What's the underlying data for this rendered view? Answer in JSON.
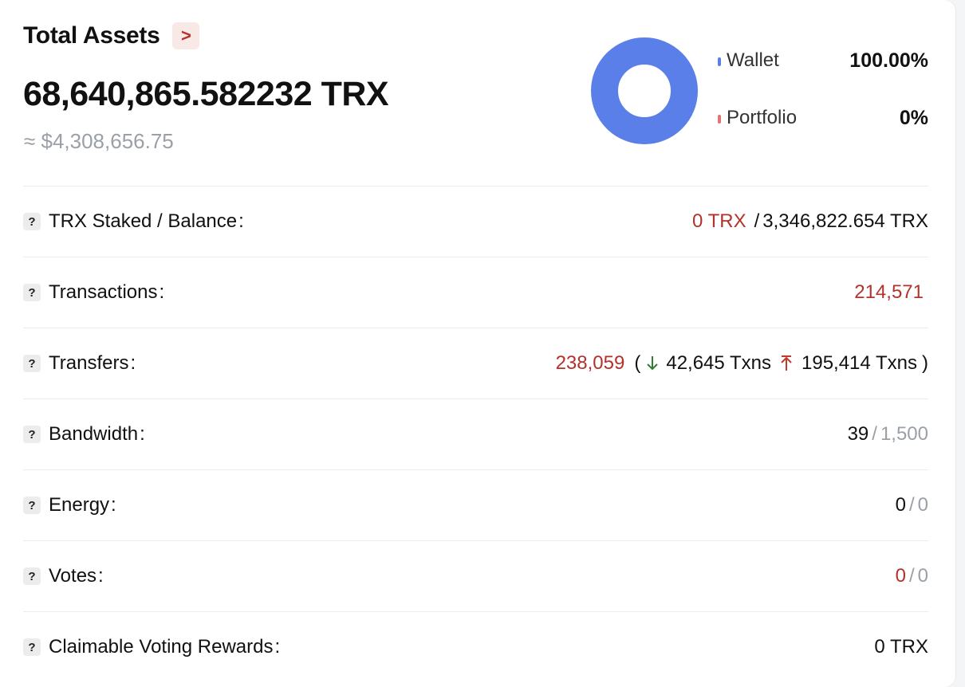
{
  "header": {
    "title": "Total Assets",
    "arrow": ">",
    "total": "68,640,865.582232 TRX",
    "usd": "≈ $4,308,656.75"
  },
  "chart_data": {
    "type": "pie",
    "categories": [
      "Wallet",
      "Portfolio"
    ],
    "values": [
      100.0,
      0
    ],
    "value_labels": [
      "100.00%",
      "0%"
    ],
    "colors": [
      "#5a7fe8",
      "#e57373"
    ]
  },
  "rows": {
    "staked": {
      "label": "TRX Staked / Balance",
      "colon": ":",
      "staked": "0 TRX",
      "slash": "/",
      "balance": "3,346,822.654 TRX"
    },
    "transactions": {
      "label": "Transactions",
      "colon": ":",
      "value": "214,571"
    },
    "transfers": {
      "label": "Transfers",
      "colon": ":",
      "total": "238,059",
      "open": "(",
      "in_count": "42,645 Txns",
      "out_count": "195,414 Txns",
      "close": ")"
    },
    "bandwidth": {
      "label": "Bandwidth",
      "colon": ":",
      "used": "39",
      "slash": "/",
      "limit": "1,500"
    },
    "energy": {
      "label": "Energy",
      "colon": ":",
      "used": "0",
      "slash": "/",
      "limit": "0"
    },
    "votes": {
      "label": "Votes",
      "colon": ":",
      "used": "0",
      "slash": "/",
      "limit": "0"
    },
    "rewards": {
      "label": "Claimable Voting Rewards",
      "colon": ":",
      "value": "0 TRX"
    }
  },
  "help_icon": "?",
  "icons": {
    "in_arrow": "arrow-down-icon",
    "out_arrow": "arrow-up-icon"
  }
}
